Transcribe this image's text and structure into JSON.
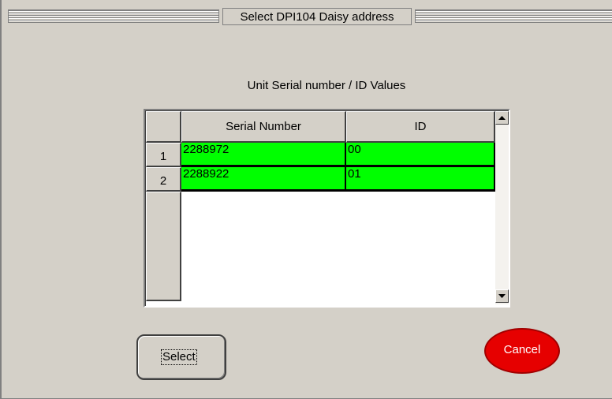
{
  "window": {
    "title": "Select DPI104  Daisy address"
  },
  "grid": {
    "caption": "Unit Serial number / ID Values",
    "columns": [
      "Serial Number",
      "ID"
    ],
    "rows": [
      {
        "num": "1",
        "serial": "2288972",
        "id": "00"
      },
      {
        "num": "2",
        "serial": "2288922",
        "id": "01"
      }
    ],
    "row_highlight_color": "#00ff00"
  },
  "buttons": {
    "select": "Select",
    "cancel": "Cancel",
    "cancel_color": "#e60000"
  },
  "icons": {
    "scroll_up": "scroll-up-arrow-icon",
    "scroll_down": "scroll-down-arrow-icon"
  }
}
